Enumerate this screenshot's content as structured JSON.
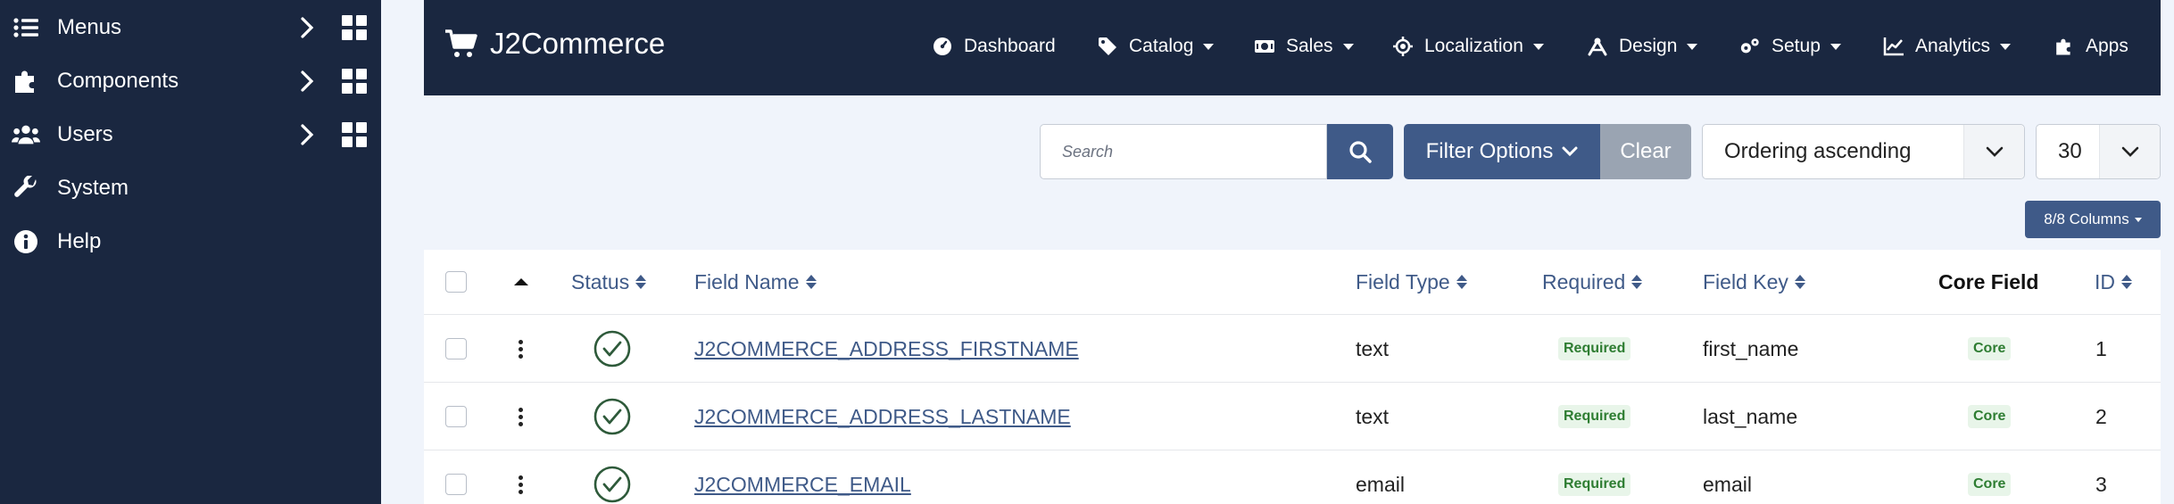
{
  "sidebar": {
    "items": [
      {
        "label": "Menus",
        "icon": "list-icon"
      },
      {
        "label": "Components",
        "icon": "puzzle-icon"
      },
      {
        "label": "Users",
        "icon": "users-icon"
      },
      {
        "label": "System",
        "icon": "wrench-icon"
      },
      {
        "label": "Help",
        "icon": "info-icon"
      }
    ]
  },
  "header": {
    "brand": "J2Commerce",
    "nav": [
      {
        "label": "Dashboard",
        "icon": "dashboard-icon"
      },
      {
        "label": "Catalog",
        "icon": "tag-icon"
      },
      {
        "label": "Sales",
        "icon": "money-icon"
      },
      {
        "label": "Localization",
        "icon": "location-icon"
      },
      {
        "label": "Design",
        "icon": "design-icon"
      },
      {
        "label": "Setup",
        "icon": "gears-icon"
      },
      {
        "label": "Analytics",
        "icon": "chart-icon"
      },
      {
        "label": "Apps",
        "icon": "puzzle-icon"
      }
    ]
  },
  "toolbar": {
    "search_placeholder": "Search",
    "filter_label": "Filter Options",
    "clear_label": "Clear",
    "ordering_value": "Ordering ascending",
    "limit_value": "30",
    "columns_label": "8/8 Columns"
  },
  "table": {
    "headers": {
      "status": "Status",
      "field_name": "Field Name",
      "field_type": "Field Type",
      "required": "Required",
      "field_key": "Field Key",
      "core_field": "Core Field",
      "id": "ID"
    },
    "rows": [
      {
        "field_name": "J2COMMERCE_ADDRESS_FIRSTNAME",
        "field_type": "text",
        "required": "Required",
        "field_key": "first_name",
        "core": "Core",
        "id": "1"
      },
      {
        "field_name": "J2COMMERCE_ADDRESS_LASTNAME",
        "field_type": "text",
        "required": "Required",
        "field_key": "last_name",
        "core": "Core",
        "id": "2"
      },
      {
        "field_name": "J2COMMERCE_EMAIL",
        "field_type": "email",
        "required": "Required",
        "field_key": "email",
        "core": "Core",
        "id": "3"
      }
    ]
  },
  "colors": {
    "sidebar_bg": "#1a2740",
    "accent": "#3f5a88",
    "success": "#2e7d32"
  }
}
